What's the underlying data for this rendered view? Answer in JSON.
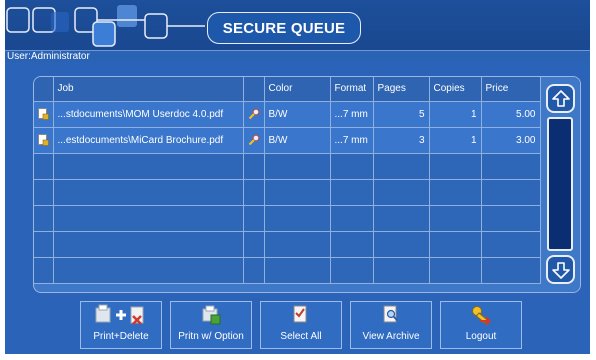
{
  "header": {
    "title": "SECURE QUEUE"
  },
  "user_bar": {
    "label": "User:Administrator"
  },
  "table": {
    "columns": [
      "Job",
      "",
      "Color",
      "Format",
      "Pages",
      "Copies",
      "Price"
    ],
    "rows": [
      {
        "job": "...stdocuments\\MOM Userdoc 4.0.pdf",
        "color": "B/W",
        "format": "...7 mm",
        "pages": "5",
        "copies": "1",
        "price": "5.00"
      },
      {
        "job": "...estdocuments\\MiCard Brochure.pdf",
        "color": "B/W",
        "format": "...7 mm",
        "pages": "3",
        "copies": "1",
        "price": "3.00"
      }
    ],
    "empty_rows": 5
  },
  "buttons": {
    "print_delete": "Print+Delete",
    "print_option": "Pritn w/ Option",
    "select_all": "Select All",
    "view_archive": "View Archive",
    "logout": "Logout"
  },
  "colors": {
    "header_bg": "#1a4891",
    "panel_bg": "#2b63b8",
    "row_filled": "#3a76cb"
  },
  "icons": [
    "document-lock-icon",
    "magnifier-icon",
    "scroll-up-icon",
    "scroll-down-icon",
    "print-delete-icon",
    "print-option-icon",
    "select-all-icon",
    "view-archive-icon",
    "logout-icon"
  ]
}
